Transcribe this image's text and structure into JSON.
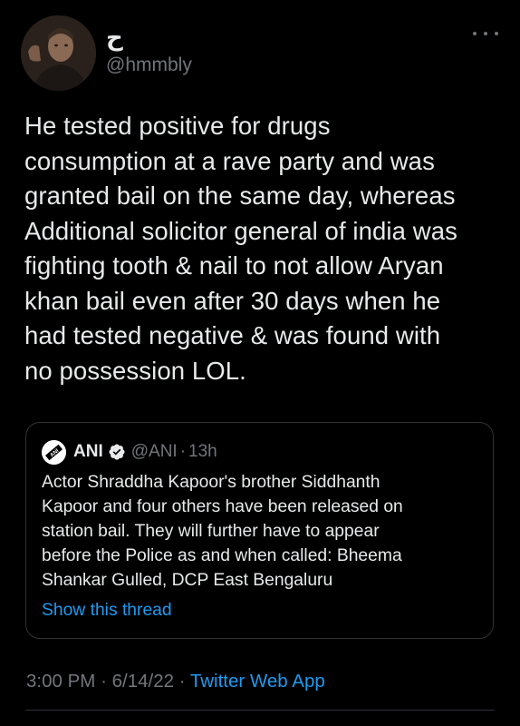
{
  "author": {
    "display_name": "ح",
    "handle": "@hmmbly"
  },
  "tweet": {
    "text": "He tested positive for drugs\nconsumption at a rave party and was\ngranted bail on the same day, whereas\nAdditional solicitor general of india was\nfighting tooth & nail to not allow Aryan\nkhan bail even after 30 days when he\nhad tested negative & was found with\nno possession LOL."
  },
  "quote": {
    "name": "ANI",
    "handle": "@ANI",
    "separator": "·",
    "time": "13h",
    "text": "Actor Shraddha Kapoor's brother Siddhanth\nKapoor and four others have been released on\nstation bail. They will further have to appear\nbefore the Police as and when called: Bheema\nShankar Gulled, DCP East Bengaluru",
    "show_thread_label": "Show this thread",
    "logo_text": "ANI"
  },
  "meta": {
    "time": "3:00 PM",
    "sep1": "·",
    "date": "6/14/22",
    "sep2": "·",
    "app": "Twitter Web App"
  },
  "colors": {
    "background": "#000000",
    "text": "#e7e9ea",
    "secondary": "#71767b",
    "accent": "#1d9bf0",
    "border": "#2f3336"
  },
  "icons": {
    "more": "more-horizontal-icon",
    "verified": "verified-badge-icon",
    "ani_logo": "ani-logo-icon"
  }
}
